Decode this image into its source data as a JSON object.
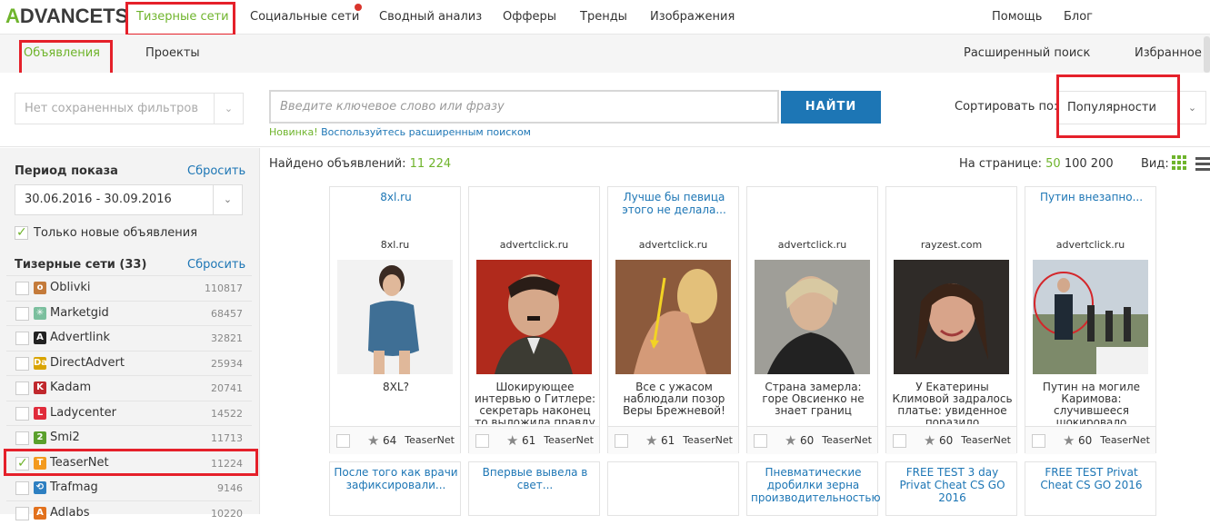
{
  "logo": {
    "a": "A",
    "rest": "DVANCETS"
  },
  "topnav": {
    "teaser": "Тизерные сети",
    "social": "Социальные сети",
    "summary": "Сводный анализ",
    "offers": "Офферы",
    "trends": "Тренды",
    "images": "Изображения",
    "help": "Помощь",
    "blog": "Блог"
  },
  "subnav": {
    "ads": "Объявления",
    "projects": "Проекты",
    "advanced": "Расширенный поиск",
    "favorites": "Избранное"
  },
  "filters": {
    "saved_placeholder": "Нет сохраненных фильтров",
    "search_placeholder": "Введите ключевое слово или фразу",
    "find_button": "НАЙТИ",
    "hint_new": "Новинка!",
    "hint_link": "Воспользуйтесь расширенным поиском",
    "sort_label": "Сортировать по:",
    "sort_value": "Популярности"
  },
  "sidebar": {
    "period_title": "Период показа",
    "reset": "Сбросить",
    "period_value": "30.06.2016 - 30.09.2016",
    "new_only": "Только новые объявления",
    "networks_title": "Тизерные сети (33)",
    "networks": [
      {
        "name": "Oblivki",
        "count": "110817",
        "checked": false,
        "icon_color": "#c47b3b"
      },
      {
        "name": "Marketgid",
        "count": "68457",
        "checked": false,
        "icon_color": "#7bbf9e"
      },
      {
        "name": "Advertlink",
        "count": "32821",
        "checked": false,
        "icon_color": "#222222"
      },
      {
        "name": "DirectAdvert",
        "count": "25934",
        "checked": false,
        "icon_color": "#d9a400"
      },
      {
        "name": "Kadam",
        "count": "20741",
        "checked": false,
        "icon_color": "#c0282d"
      },
      {
        "name": "Ladycenter",
        "count": "14522",
        "checked": false,
        "icon_color": "#e02b3a"
      },
      {
        "name": "Smi2",
        "count": "11713",
        "checked": false,
        "icon_color": "#5aa02c"
      },
      {
        "name": "TeaserNet",
        "count": "11224",
        "checked": true,
        "icon_color": "#f39a1e"
      },
      {
        "name": "Trafmag",
        "count": "9146",
        "checked": false,
        "icon_color": "#2d7fc1"
      },
      {
        "name": "Adlabs",
        "count": "10220",
        "checked": false,
        "icon_color": "#e2711d"
      }
    ]
  },
  "results": {
    "found_label": "Найдено объявлений:",
    "found_count": "11 224",
    "per_page_label": "На странице:",
    "per_page_50": "50",
    "per_page_100": "100",
    "per_page_200": "200",
    "view_label": "Вид:"
  },
  "cards": [
    {
      "title": "8xl.ru",
      "domain": "8xl.ru",
      "text": "8XL?",
      "likes": "64",
      "network": "TeaserNet"
    },
    {
      "title": "",
      "domain": "advertclick.ru",
      "text": "Шокирующее интервью о Гитлере: секретарь наконец то выложила правду",
      "likes": "61",
      "network": "TeaserNet"
    },
    {
      "title": "Лучше бы певица этого не делала...",
      "domain": "advertclick.ru",
      "text": "Все с ужасом наблюдали позор Веры Брежневой!",
      "likes": "61",
      "network": "TeaserNet"
    },
    {
      "title": "",
      "domain": "advertclick.ru",
      "text": "Страна замерла: горе Овсиенко не знает границ",
      "likes": "60",
      "network": "TeaserNet"
    },
    {
      "title": "",
      "domain": "rayzest.com",
      "text": "У Екатерины Климовой задралось платье: увиденное поразило",
      "likes": "60",
      "network": "TeaserNet"
    },
    {
      "title": "Путин внезапно...",
      "domain": "advertclick.ru",
      "text": "Путин на могиле Каримова: случившееся шокировало",
      "likes": "60",
      "network": "TeaserNet"
    }
  ],
  "cards_row2": [
    {
      "title": "После того как врачи зафиксировали..."
    },
    {
      "title": "Впервые вывела в свет..."
    },
    {
      "title": ""
    },
    {
      "title": "Пневматические дробилки зерна производительностью"
    },
    {
      "title": "FREE TEST 3 day Privat Cheat CS GO 2016"
    },
    {
      "title": "FREE TEST Privat Cheat CS GO 2016"
    }
  ]
}
